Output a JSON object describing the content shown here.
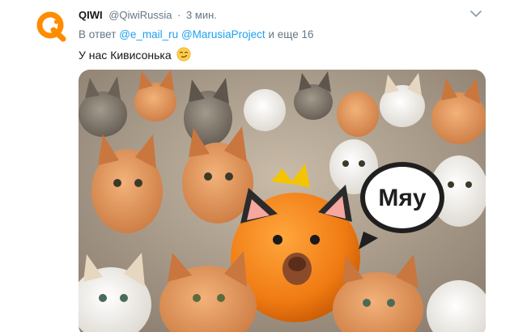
{
  "tweet": {
    "author": {
      "display_name": "QIWI",
      "handle": "@QiwiRussia",
      "avatar_icon": "qiwi-logo-icon"
    },
    "timestamp": "3 мин.",
    "menu_icon": "chevron-down-icon",
    "reply": {
      "prefix": "В ответ",
      "mentions": [
        "@e_mail_ru",
        "@MarusiaProject"
      ],
      "more_text": "и еще 16"
    },
    "text": "У нас Кивисонька",
    "emoji": "smirking-face-emoji",
    "media": {
      "speech_bubble_text": "Мяу"
    }
  },
  "colors": {
    "link": "#1da1f2",
    "secondary_text": "#657786",
    "primary_text": "#14171a",
    "qiwi_orange": "#ff8c00"
  }
}
